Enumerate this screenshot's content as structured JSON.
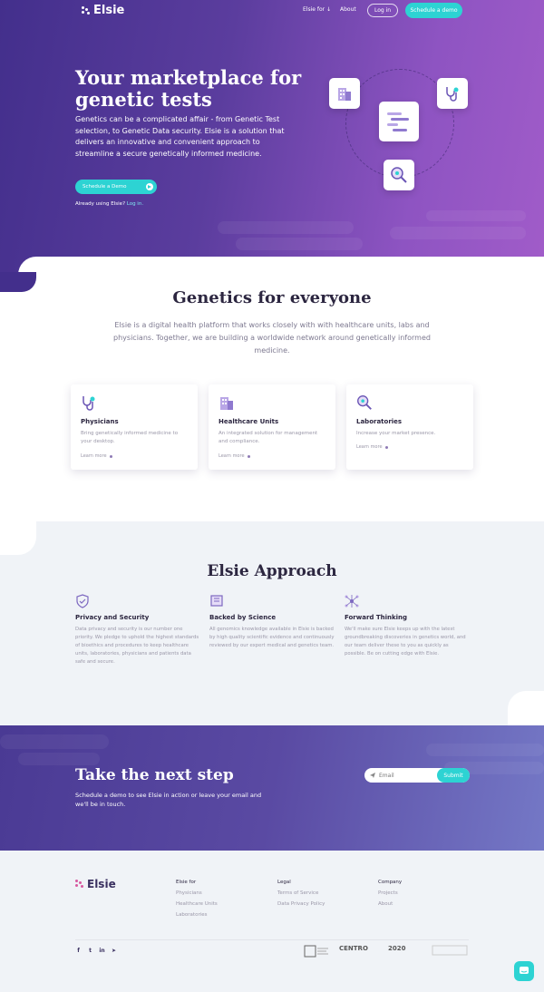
{
  "nav": {
    "brand": "Elsie",
    "links": [
      "Elsie for ↓",
      "About"
    ],
    "login": "Log in",
    "schedule": "Schedule a demo"
  },
  "hero": {
    "title": "Your marketplace for genetic tests",
    "text": "Genetics can be a complicated affair - from Genetic Test selection, to Genetic Data security. Elsie is a solution that delivers an innovative and convenient approach to streamline a secure genetically informed medicine.",
    "cta": "Schedule a Demo",
    "already": "Already using Elsie?",
    "login_link": "Log in."
  },
  "genetics": {
    "title": "Genetics for everyone",
    "text": "Elsie is a digital health platform that works closely with with healthcare units, labs and physicians. Together, we are building a worldwide network around genetically informed medicine.",
    "cards": [
      {
        "title": "Physicians",
        "text": "Bring genetically informed medicine to your desktop.",
        "more": "Learn more"
      },
      {
        "title": "Healthcare Units",
        "text": "An integrated solution for management and compliance.",
        "more": "Learn more"
      },
      {
        "title": "Laboratories",
        "text": "Increase your market presence.",
        "more": "Learn more"
      }
    ]
  },
  "approach": {
    "title": "Elsie Approach",
    "items": [
      {
        "title": "Privacy and Security",
        "text": "Data privacy and security is our number one priority. We pledge to uphold the highest standards of bioethics and procedures to keep healthcare units, laboratories, physicians and patients data safe and secure."
      },
      {
        "title": "Backed by Science",
        "text": "All genomics knowledge available in Elsie is backed by high quality scientific evidence and continuously reviewed by our expert medical and genetics team."
      },
      {
        "title": "Forward Thinking",
        "text": "We'll make sure Elsie keeps up with the latest groundbreaking discoveries in genetics world, and our team deliver these to you as quickly as possible. Be on cutting edge with Elsie."
      }
    ]
  },
  "cta": {
    "title": "Take the next step",
    "text": "Schedule a demo to see Elsie in action or leave your email and we'll be in touch.",
    "email_placeholder": "Email",
    "submit": "Submit"
  },
  "footer": {
    "brand": "Elsie",
    "columns": [
      {
        "head": "Elsie for",
        "items": [
          "Physicians",
          "Healthcare Units",
          "Laboratories"
        ]
      },
      {
        "head": "Legal",
        "items": [
          "Terms of Service",
          "Data Privacy Policy"
        ]
      },
      {
        "head": "Company",
        "items": [
          "Projects",
          "About"
        ]
      }
    ],
    "partners": [
      "CENTRO",
      "2020"
    ]
  },
  "colors": {
    "accent": "#2dd3d3",
    "purple_dark": "#432f8c",
    "purple_light": "#a15cc9"
  }
}
